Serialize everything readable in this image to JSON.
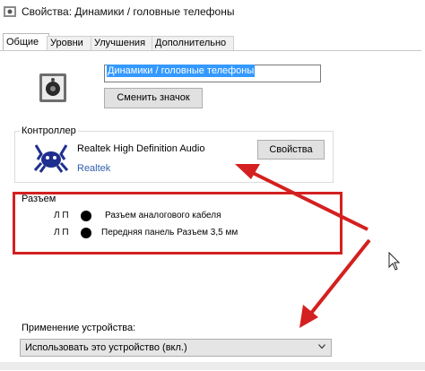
{
  "window": {
    "title": "Свойства: Динамики / головные телефоны"
  },
  "tabs": [
    {
      "label": "Общие",
      "active": true
    },
    {
      "label": "Уровни",
      "active": false
    },
    {
      "label": "Улучшения",
      "active": false
    },
    {
      "label": "Дополнительно",
      "active": false
    }
  ],
  "general": {
    "device_name": "Динамики / головные телефоны",
    "change_icon_label": "Сменить значок"
  },
  "controller": {
    "legend": "Контроллер",
    "name": "Realtek High Definition Audio",
    "vendor": "Realtek",
    "properties_label": "Свойства"
  },
  "jacks": {
    "legend": "Разъем",
    "items": [
      {
        "side": "Л П",
        "label": "Разъем аналогового кабеля",
        "color": "#000000"
      },
      {
        "side": "Л П",
        "label": "Передняя панель Разъем 3,5 мм",
        "color": "#000000"
      }
    ]
  },
  "usage": {
    "label": "Применение устройства:",
    "selected": "Использовать это устройство (вкл.)"
  },
  "colors": {
    "annotation": "#d42020",
    "link": "#3060b0",
    "selection": "#3399ff"
  },
  "icons": {
    "title": "speaker-icon",
    "device": "speaker-icon",
    "controller": "realtek-crab-icon",
    "dropdown": "chevron-down-icon"
  }
}
